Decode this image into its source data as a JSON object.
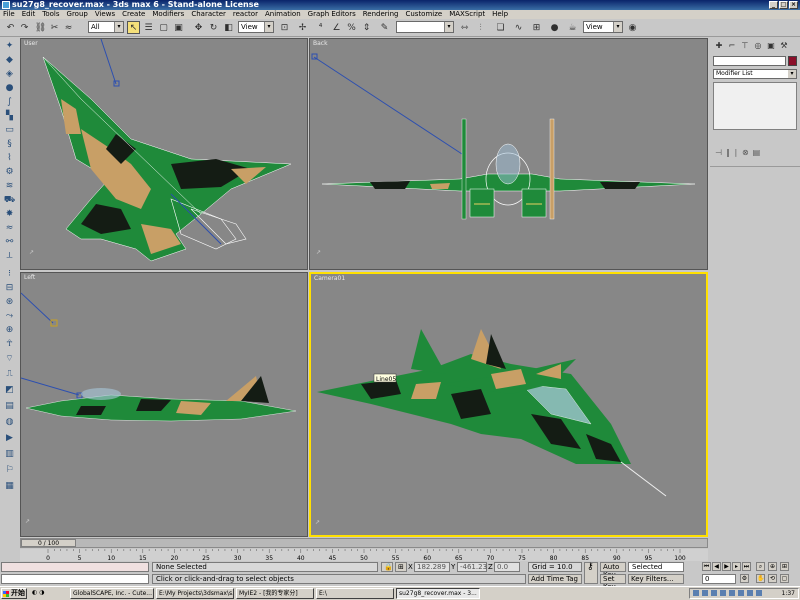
{
  "window": {
    "title": "su27g8_recover.max - 3ds max 6 - Stand-alone License"
  },
  "menu": [
    "File",
    "Edit",
    "Tools",
    "Group",
    "Views",
    "Create",
    "Modifiers",
    "Character",
    "reactor",
    "Animation",
    "Graph Editors",
    "Rendering",
    "Customize",
    "MAXScript",
    "Help"
  ],
  "toolbar": {
    "selection_filter": "All",
    "ref_coord": "View",
    "named_selection": "",
    "ref_coord2": "View"
  },
  "viewports": {
    "top_left": "User",
    "top_right": "Back",
    "bottom_left": "Left",
    "bottom_right": "Camera01"
  },
  "object_label": "Line05",
  "command_panel": {
    "modifier_list": "Modifier List",
    "name_color": "#8a0f2a"
  },
  "time": {
    "slider": "0 / 100",
    "ticks": [
      "0",
      "5",
      "10",
      "15",
      "20",
      "25",
      "30",
      "35",
      "40",
      "45",
      "50",
      "55",
      "60",
      "65",
      "70",
      "75",
      "80",
      "85",
      "90",
      "95",
      "100"
    ]
  },
  "status": {
    "selection": "None Selected",
    "prompt": "Click or click-and-drag to select objects",
    "x_label": "X",
    "x": "182.289",
    "y_label": "Y",
    "y": "-461.23",
    "z_label": "Z",
    "z": "0.0",
    "grid": "Grid = 10.0",
    "add_time_tag": "Add Time Tag",
    "auto_key": "Auto Key",
    "set_key": "Set Key",
    "key_mode": "Selected",
    "key_filters": "Key Filters...",
    "frame": "0"
  },
  "taskbar": {
    "start": "开始",
    "items": [
      "GlobalSCAPE, Inc. - Cute...",
      "E:\\My Projects\\3dsmax\\s...",
      "MyIE2 - [我的专家分]",
      "E:\\",
      "su27g8_recover.max - 3..."
    ],
    "clock": "1:37"
  },
  "colors": {
    "camo_green": "#1f8a3a",
    "camo_tan": "#c89f66",
    "camo_dark": "#141c14",
    "viewport_bg": "#878787",
    "active_border": "#ffe000"
  }
}
